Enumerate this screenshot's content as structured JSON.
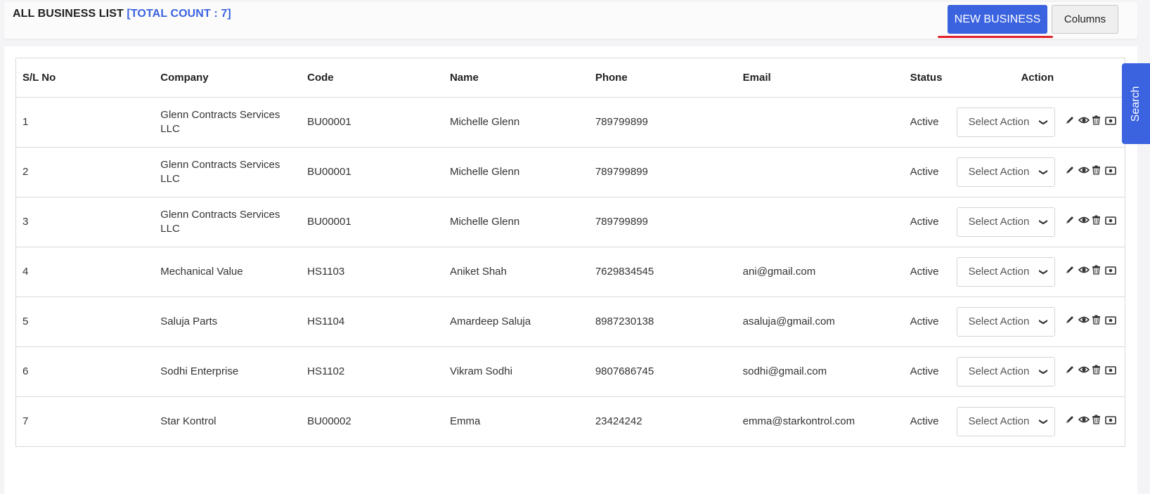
{
  "header": {
    "title": "ALL BUSINESS LIST",
    "count_label": "[TOTAL COUNT : 7]",
    "new_button": "NEW BUSINESS",
    "columns_button": "Columns"
  },
  "search_tab": "Search",
  "columns": [
    "S/L No",
    "Company",
    "Code",
    "Name",
    "Phone",
    "Email",
    "Status",
    "Action"
  ],
  "select_placeholder": "Select Action",
  "rows": [
    {
      "sl": "1",
      "company": "Glenn Contracts Services LLC",
      "code": "BU00001",
      "name": "Michelle Glenn",
      "phone": "789799899",
      "email": "",
      "status": "Active"
    },
    {
      "sl": "2",
      "company": "Glenn Contracts Services LLC",
      "code": "BU00001",
      "name": "Michelle Glenn",
      "phone": "789799899",
      "email": "",
      "status": "Active"
    },
    {
      "sl": "3",
      "company": "Glenn Contracts Services LLC",
      "code": "BU00001",
      "name": "Michelle Glenn",
      "phone": "789799899",
      "email": "",
      "status": "Active"
    },
    {
      "sl": "4",
      "company": "Mechanical Value",
      "code": "HS1103",
      "name": "Aniket Shah",
      "phone": "7629834545",
      "email": "ani@gmail.com",
      "status": "Active"
    },
    {
      "sl": "5",
      "company": "Saluja Parts",
      "code": "HS1104",
      "name": "Amardeep Saluja",
      "phone": "8987230138",
      "email": "asaluja@gmail.com",
      "status": "Active"
    },
    {
      "sl": "6",
      "company": "Sodhi Enterprise",
      "code": "HS1102",
      "name": "Vikram Sodhi",
      "phone": "9807686745",
      "email": "sodhi@gmail.com",
      "status": "Active"
    },
    {
      "sl": "7",
      "company": "Star Kontrol",
      "code": "BU00002",
      "name": "Emma",
      "phone": "23424242",
      "email": "emma@starkontrol.com",
      "status": "Active"
    }
  ],
  "row_icons": [
    "pencil-icon",
    "eye-icon",
    "trash-icon",
    "money-icon"
  ],
  "colors": {
    "accent": "#3b63e0",
    "highlight": "#e0222a"
  }
}
